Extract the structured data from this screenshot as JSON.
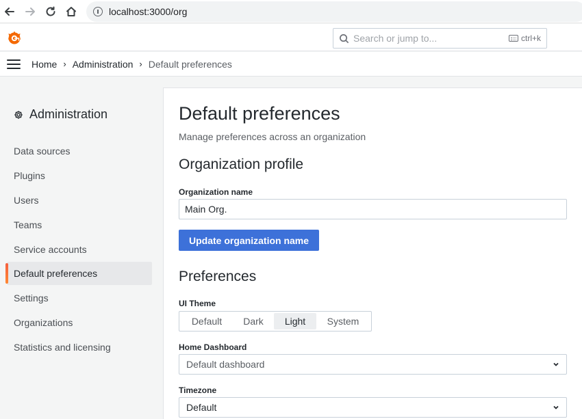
{
  "browser": {
    "url": "localhost:3000/org"
  },
  "topbar": {
    "search_placeholder": "Search or jump to...",
    "shortcut": "ctrl+k"
  },
  "breadcrumb": {
    "items": [
      "Home",
      "Administration",
      "Default preferences"
    ]
  },
  "sidebar": {
    "title": "Administration",
    "items": [
      {
        "label": "Data sources"
      },
      {
        "label": "Plugins"
      },
      {
        "label": "Users"
      },
      {
        "label": "Teams"
      },
      {
        "label": "Service accounts"
      },
      {
        "label": "Default preferences",
        "active": true
      },
      {
        "label": "Settings"
      },
      {
        "label": "Organizations"
      },
      {
        "label": "Statistics and licensing"
      }
    ]
  },
  "main": {
    "title": "Default preferences",
    "subtitle": "Manage preferences across an organization",
    "org_profile": {
      "heading": "Organization profile",
      "name_label": "Organization name",
      "name_value": "Main Org.",
      "update_button": "Update organization name"
    },
    "preferences": {
      "heading": "Preferences",
      "theme_label": "UI Theme",
      "theme_options": [
        "Default",
        "Dark",
        "Light",
        "System"
      ],
      "theme_selected": "Light",
      "home_dashboard_label": "Home Dashboard",
      "home_dashboard_value": "Default dashboard",
      "timezone_label": "Timezone",
      "timezone_value": "Default"
    }
  },
  "colors": {
    "primary_button": "#3d71d9",
    "active_indicator": "#f55f3e",
    "logo": "#f46800"
  }
}
